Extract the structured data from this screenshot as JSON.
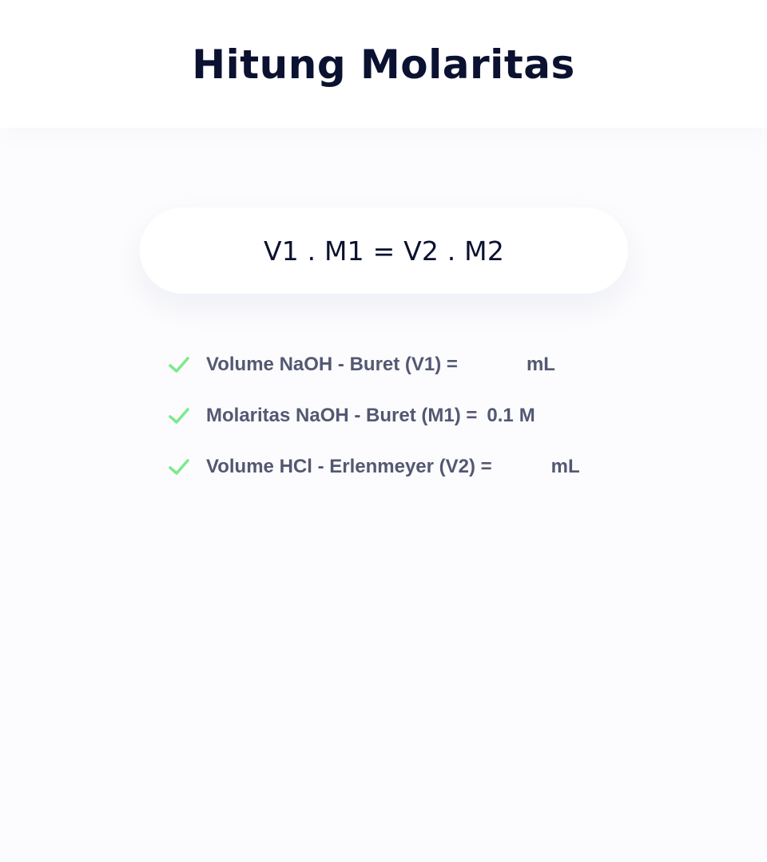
{
  "header": {
    "title": "Hitung Molaritas"
  },
  "formula": {
    "text": "V1 . M1 = V2 . M2"
  },
  "items": [
    {
      "label": "Volume NaOH - Buret (V1) =",
      "value": "",
      "unit": "mL",
      "icon": "check-icon"
    },
    {
      "label": "Molaritas NaOH - Buret (M1) =",
      "value": "0.1",
      "unit": "M",
      "icon": "check-icon"
    },
    {
      "label": "Volume HCl - Erlenmeyer (V2) =",
      "value": "",
      "unit": "mL",
      "icon": "check-icon"
    }
  ],
  "colors": {
    "check": "#7dea8a",
    "title": "#0b1130",
    "text": "#535872",
    "background": "#fcfcfe"
  }
}
